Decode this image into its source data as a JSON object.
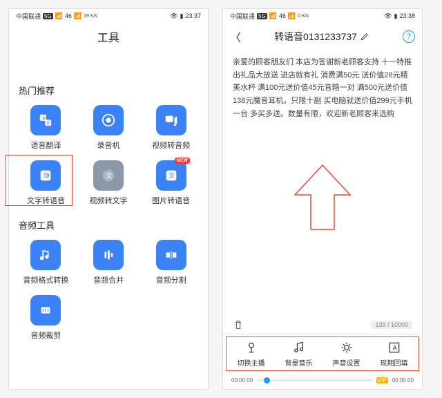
{
  "left": {
    "status": {
      "carrier": "中国联通",
      "net1": "5G",
      "net2": "46",
      "speed": "19\nK/s",
      "time": "23:37"
    },
    "title": "工具",
    "section1": "热门推荐",
    "apps1": [
      {
        "label": "语音翻译"
      },
      {
        "label": "录音机"
      },
      {
        "label": "视频转音频"
      },
      {
        "label": "文字转语音",
        "hl": true
      },
      {
        "label": "视频转文字"
      },
      {
        "label": "图片转语音",
        "new": "NEW"
      }
    ],
    "section2": "音频工具",
    "apps2": [
      {
        "label": "音频格式转换"
      },
      {
        "label": "音频合并"
      },
      {
        "label": "音频分割"
      },
      {
        "label": "音频裁剪"
      }
    ]
  },
  "right": {
    "status": {
      "carrier": "中国联通",
      "net1": "5G",
      "net2": "46",
      "speed": "0\nK/s",
      "time": "23:38"
    },
    "title": "转语音0131233737",
    "help": "?",
    "text": "亲爱的顾客朋友们 本店为答谢新老顾客支持 十一特推出礼品大放送 进店就有礼 消费满50元 送价值28元精美水杯 满100元送价值45元音箱一对 满500元送价值138元魔音耳机。只限十副 买电脑就送价值299元手机一台 多买多送。数量有限，欢迎新老顾客来选购",
    "counter": "139 / 10000",
    "tools": [
      {
        "label": "切换主播"
      },
      {
        "label": "背景音乐"
      },
      {
        "label": "声音设置"
      },
      {
        "label": "现期回填"
      }
    ],
    "t0": "00:00:00",
    "t1": "00:00:00"
  }
}
